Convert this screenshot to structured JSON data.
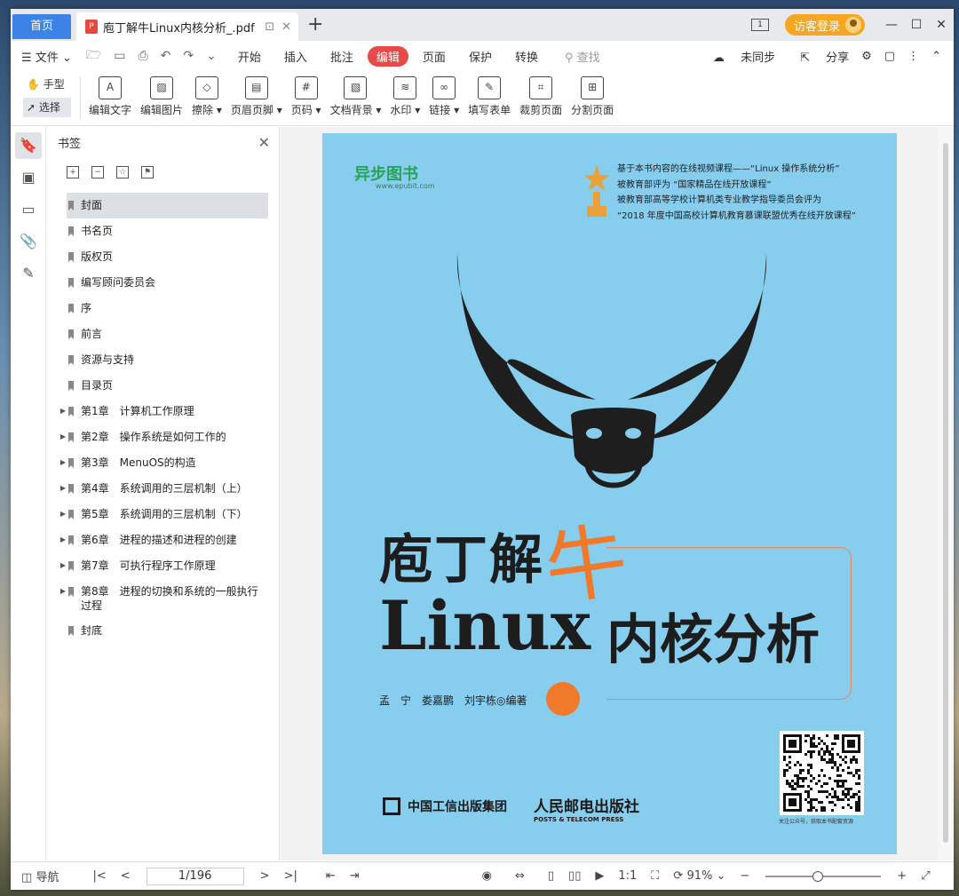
{
  "tabs": {
    "home": "首页",
    "document": "庖丁解牛Linux内核分析_.pdf",
    "new_tab": "+"
  },
  "titlebar": {
    "page_indicator": "1",
    "login": "访客登录"
  },
  "menu": {
    "file": "文件",
    "tabs": [
      "开始",
      "插入",
      "批注",
      "编辑",
      "页面",
      "保护",
      "转换"
    ],
    "active_tab": "编辑",
    "search_placeholder": "查找",
    "sync": "未同步",
    "share": "分享"
  },
  "ribbon": {
    "modes": [
      "手型",
      "选择"
    ],
    "tools": [
      {
        "label": "编辑文字",
        "icon": "edit-text-icon"
      },
      {
        "label": "编辑图片",
        "icon": "edit-image-icon"
      },
      {
        "label": "擦除 ▾",
        "icon": "eraser-icon"
      },
      {
        "label": "页眉页脚 ▾",
        "icon": "header-footer-icon"
      },
      {
        "label": "页码 ▾",
        "icon": "page-number-icon"
      },
      {
        "label": "文档背景 ▾",
        "icon": "background-icon"
      },
      {
        "label": "水印 ▾",
        "icon": "watermark-icon"
      },
      {
        "label": "链接 ▾",
        "icon": "link-icon"
      },
      {
        "label": "填写表单",
        "icon": "form-icon"
      },
      {
        "label": "裁剪页面",
        "icon": "crop-icon"
      },
      {
        "label": "分割页面",
        "icon": "split-icon"
      }
    ]
  },
  "bookmarks": {
    "title": "书签",
    "items": [
      {
        "label": "封面",
        "expandable": false,
        "selected": true
      },
      {
        "label": "书名页",
        "expandable": false
      },
      {
        "label": "版权页",
        "expandable": false
      },
      {
        "label": "编写顾问委员会",
        "expandable": false
      },
      {
        "label": "序",
        "expandable": false
      },
      {
        "label": "前言",
        "expandable": false
      },
      {
        "label": "资源与支持",
        "expandable": false
      },
      {
        "label": "目录页",
        "expandable": false
      },
      {
        "label": "第1章　计算机工作原理",
        "expandable": true
      },
      {
        "label": "第2章　操作系统是如何工作的",
        "expandable": true
      },
      {
        "label": "第3章　MenuOS的构造",
        "expandable": true
      },
      {
        "label": "第4章　系统调用的三层机制（上）",
        "expandable": true
      },
      {
        "label": "第5章　系统调用的三层机制（下）",
        "expandable": true
      },
      {
        "label": "第6章　进程的描述和进程的创建",
        "expandable": true
      },
      {
        "label": "第7章　可执行程序工作原理",
        "expandable": true
      },
      {
        "label": "第8章　进程的切换和系统的一般执行过程",
        "expandable": true
      },
      {
        "label": "封底",
        "expandable": false
      }
    ]
  },
  "cover": {
    "publisher_logo": "异步图书",
    "publisher_url": "www.epubit.com",
    "award_lines": [
      "基于本书内容的在线视频课程——“Linux 操作系统分析”",
      "被教育部评为 “国家精品在线开放课程”",
      "被教育部高等学校计算机类专业教学指导委员会评为",
      "“2018 年度中国高校计算机教育慕课联盟优秀在线开放课程”"
    ],
    "title_part1": "庖丁解",
    "title_niu": "牛",
    "title_en": "Linux",
    "title_part2": "内核分析",
    "authors": "孟　宁　娄嘉鹏　刘宇栋◎编著",
    "publisher1": "中国工信出版集团",
    "publisher2_zh": "人民邮电出版社",
    "publisher2_en": "POSTS & TELECOM PRESS",
    "qr_caption": "关注公众号，获取本书配套资源",
    "bg_color": "#87cdee",
    "accent_color": "#f07a2a"
  },
  "statusbar": {
    "nav": "导航",
    "page": "1/196",
    "zoom": "91%",
    "zoom_fraction": 0.45
  }
}
